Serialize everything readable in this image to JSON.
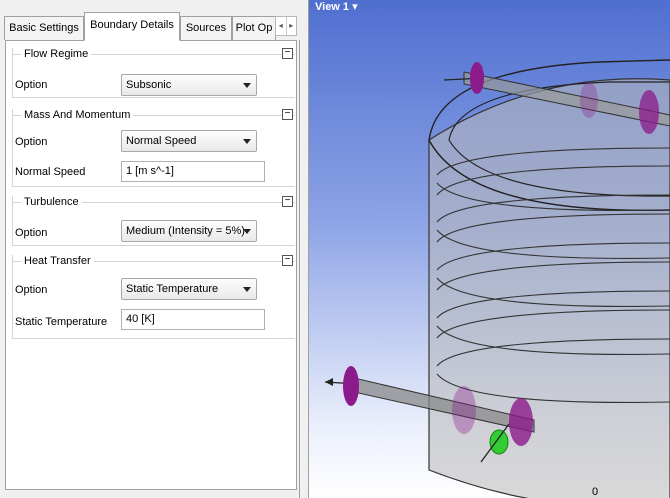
{
  "tabs": [
    {
      "label": "Basic Settings",
      "active": false
    },
    {
      "label": "Boundary Details",
      "active": true
    },
    {
      "label": "Sources",
      "active": false
    },
    {
      "label": "Plot Op",
      "active": false
    }
  ],
  "tab_scroll": {
    "left": "◂",
    "right": "▸"
  },
  "groups": {
    "flow_regime": {
      "title": "Flow Regime",
      "collapse": "−",
      "option_label": "Option",
      "option_value": "Subsonic"
    },
    "mass_momentum": {
      "title": "Mass And Momentum",
      "collapse": "−",
      "option_label": "Option",
      "option_value": "Normal Speed",
      "speed_label": "Normal Speed",
      "speed_value": "1 [m s^-1]"
    },
    "turbulence": {
      "title": "Turbulence",
      "collapse": "−",
      "option_label": "Option",
      "option_value": "Medium (Intensity = 5%)"
    },
    "heat_transfer": {
      "title": "Heat Transfer",
      "collapse": "−",
      "option_label": "Option",
      "option_value": "Static Temperature",
      "temp_label": "Static Temperature",
      "temp_value": "40 [K]"
    }
  },
  "viewport": {
    "title": "View 1 ▾",
    "axis_label": "0"
  },
  "colors": {
    "background_top": "#4f6fd0",
    "background_bottom": "#ffffff",
    "boundary_marker": "#8b1a8b",
    "selection_green": "#33cc33"
  }
}
